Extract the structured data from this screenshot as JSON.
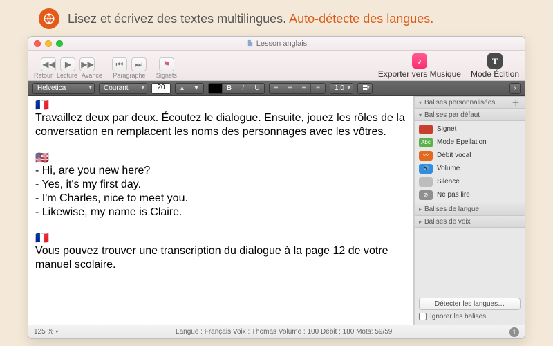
{
  "marketing": {
    "line1": "Lisez et écrivez des textes multilingues. ",
    "line2": "Auto-détecte des langues."
  },
  "title": "Lesson anglais",
  "toolbar": {
    "retour": "Retour",
    "lecture": "Lecture",
    "avance": "Avance",
    "paragraphe": "Paragraphe",
    "signets": "Signets",
    "exporter": "Exporter vers Musique",
    "mode_edition": "Mode Édition"
  },
  "format": {
    "font": "Helvetica",
    "style": "Courant",
    "size": "20",
    "spacing": "1.0"
  },
  "document": {
    "p1": "Travaillez deux par deux. Écoutez le dialogue. Ensuite, jouez les rôles de la conversation en remplacent les noms des personnages avec les vôtres.",
    "l1": "- Hi, are you new here?",
    "l2": "- Yes, it's my first day.",
    "l3": "- I'm Charles, nice to meet you.",
    "l4": "- Likewise, my name is Claire.",
    "p2": "Vous pouvez trouver une transcription du dialogue à la page 12 de votre manuel scolaire."
  },
  "sidebar": {
    "personnalisees": "Balises personnalisées",
    "defaut": "Balises par défaut",
    "items": [
      {
        "label": "Signet",
        "color": "#c7402e",
        "txt": ""
      },
      {
        "label": "Mode Épellation",
        "color": "#5bb24a",
        "txt": "Abc"
      },
      {
        "label": "Débit vocal",
        "color": "#e26a1f",
        "txt": "〰"
      },
      {
        "label": "Volume",
        "color": "#2f8fe0",
        "txt": "🔊"
      },
      {
        "label": "Silence",
        "color": "#bdbdbd",
        "txt": "…"
      },
      {
        "label": "Ne pas lire",
        "color": "#8f8f8f",
        "txt": "⊘"
      }
    ],
    "langue": "Balises de langue",
    "voix": "Balises de voix",
    "detect": "Détecter les langues…",
    "ignorer": "Ignorer les balises"
  },
  "status": {
    "zoom": "125 %",
    "center": "Langue : Français    Voix : Thomas    Volume : 100    Débit : 180    Mots: 59/59",
    "corner": "1"
  }
}
